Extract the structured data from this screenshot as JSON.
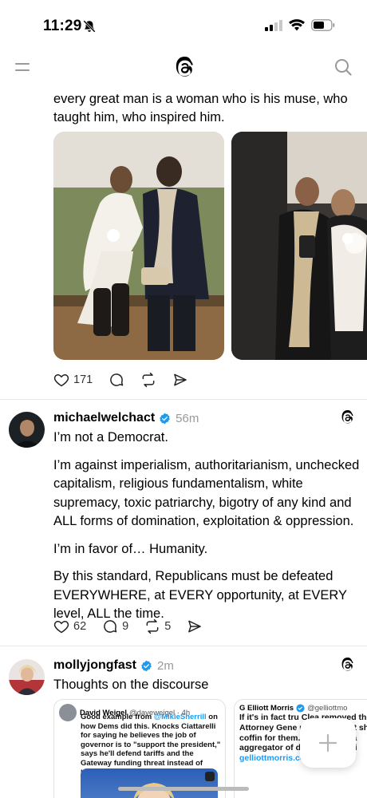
{
  "status_bar": {
    "time": "11:29"
  },
  "nav": {
    "menu_icon": "menu-icon",
    "logo_icon": "threads-logo",
    "search_icon": "search-icon"
  },
  "post1": {
    "text_continued": "every great man is a woman who is his muse, who taught him, who inspired him.",
    "likes": "171"
  },
  "post2": {
    "username": "michaelwelchact",
    "time": "56m",
    "paragraphs": [
      "I’m not a Democrat.",
      "I’m against imperialism, authoritarianism, unchecked capitalism, religious fundamentalism, white supremacy, toxic patriarchy, bigotry of any kind and ALL forms of domination, exploitation & oppression.",
      "I’m in favor of… Humanity.",
      "By this standard, Republicans must be defeated EVERYWHERE, at EVERY opportunity, at EVERY level, ALL the time."
    ],
    "likes": "62",
    "replies": "9",
    "reposts": "5"
  },
  "post3": {
    "username": "mollyjongfast",
    "time": "2m",
    "text": "Thoughts on the discourse",
    "embed1": {
      "name": "David Weigel",
      "handle": "@daveweigel · 4h",
      "text_before": "Good example from ",
      "mention": "@MikieSherrill",
      "text_after": " on how Dems did this. Knocks Ciattarelli for saying he believes the job of governor is to \"support the president,\" says he'll defend tariffs and the Gateway funding threat instead of lowering costs/creating jobs."
    },
    "embed2": {
      "name": "G Elliott Morris",
      "handle": "@gelliottmo",
      "text": "If it's in fact tru Clea removed their ge Attorney Gene us wrong, that sho the coffin for them. Hasn't been a aggregator of data in a long ti",
      "link": "gelliottmorris.com/p/the-po"
    }
  },
  "colors": {
    "verified_blue": "#1d9bf0",
    "muted_text": "#999999",
    "divider": "#e6e6e6"
  }
}
